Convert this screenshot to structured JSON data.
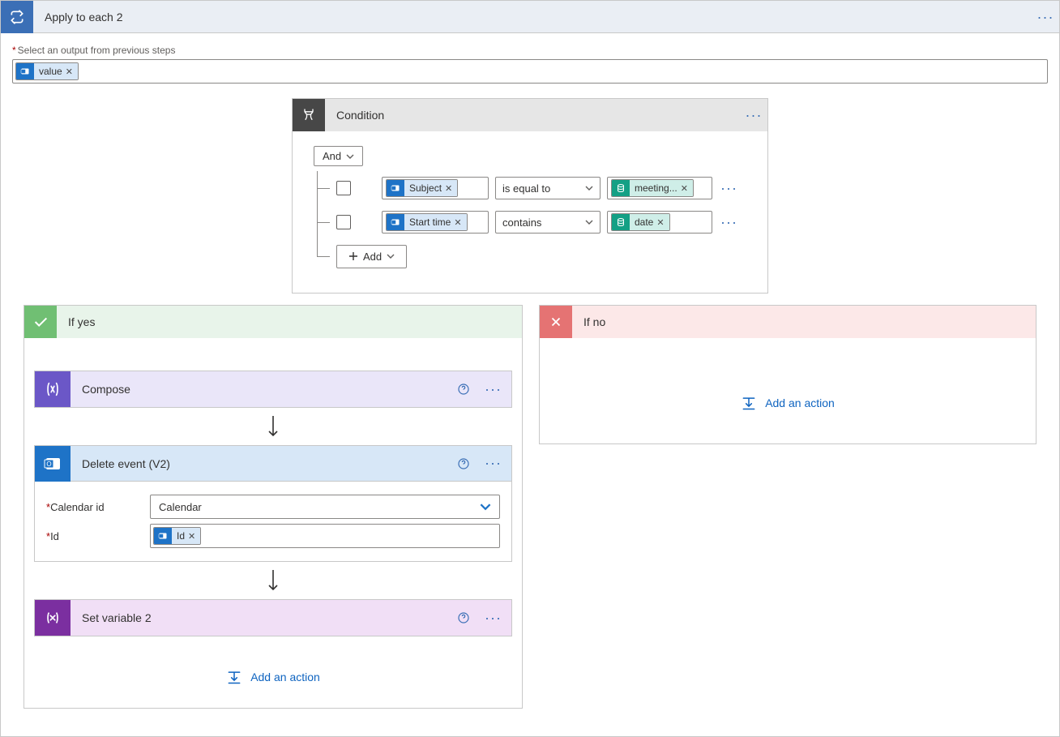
{
  "applyToEach": {
    "title": "Apply to each 2",
    "outputLabel": "Select an output from previous steps",
    "token": "value"
  },
  "condition": {
    "title": "Condition",
    "group": "And",
    "addLabel": "Add",
    "rows": [
      {
        "field": "Subject",
        "op": "is equal to",
        "value": "meeting..."
      },
      {
        "field": "Start time",
        "op": "contains",
        "value": "date"
      }
    ]
  },
  "yes": {
    "title": "If yes",
    "compose": "Compose",
    "delete": {
      "title": "Delete event (V2)",
      "calLabel": "Calendar id",
      "calValue": "Calendar",
      "idLabel": "Id",
      "idToken": "Id"
    },
    "setvar": "Set variable 2",
    "addAction": "Add an action"
  },
  "no": {
    "title": "If no",
    "addAction": "Add an action"
  }
}
